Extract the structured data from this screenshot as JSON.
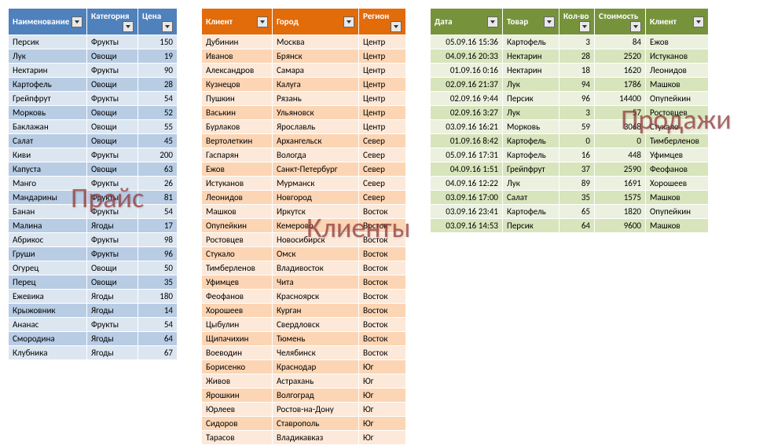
{
  "watermarks": {
    "t1": "Прайс",
    "t2": "Клиенты",
    "t3": "Продажи"
  },
  "chart_data": [
    {
      "type": "table",
      "name": "price",
      "cols": [
        "Наименование",
        "Категория",
        "Цена"
      ],
      "widths": [
        100,
        65,
        50
      ],
      "rows": [
        [
          "Персик",
          "Фрукты",
          "150"
        ],
        [
          "Лук",
          "Овощи",
          "19"
        ],
        [
          "Нектарин",
          "Фрукты",
          "90"
        ],
        [
          "Картофель",
          "Овощи",
          "28"
        ],
        [
          "Грейпфрут",
          "Фрукты",
          "54"
        ],
        [
          "Морковь",
          "Овощи",
          "52"
        ],
        [
          "Баклажан",
          "Овощи",
          "55"
        ],
        [
          "Салат",
          "Овощи",
          "45"
        ],
        [
          "Киви",
          "Фрукты",
          "200"
        ],
        [
          "Капуста",
          "Овощи",
          "63"
        ],
        [
          "Манго",
          "Фрукты",
          "26"
        ],
        [
          "Мандарины",
          "Фрукты",
          "81"
        ],
        [
          "Банан",
          "Фрукты",
          "54"
        ],
        [
          "Малина",
          "Ягоды",
          "17"
        ],
        [
          "Абрикос",
          "Фрукты",
          "98"
        ],
        [
          "Груши",
          "Фрукты",
          "96"
        ],
        [
          "Огурец",
          "Овощи",
          "50"
        ],
        [
          "Перец",
          "Овощи",
          "35"
        ],
        [
          "Ежевика",
          "Ягоды",
          "180"
        ],
        [
          "Крыжовник",
          "Ягоды",
          "14"
        ],
        [
          "Ананас",
          "Фрукты",
          "54"
        ],
        [
          "Смородина",
          "Ягоды",
          "64"
        ],
        [
          "Клубника",
          "Ягоды",
          "67"
        ]
      ]
    },
    {
      "type": "table",
      "name": "clients",
      "cols": [
        "Клиент",
        "Город",
        "Регион"
      ],
      "widths": [
        90,
        110,
        60
      ],
      "rows": [
        [
          "Дубинин",
          "Москва",
          "Центр"
        ],
        [
          "Иванов",
          "Брянск",
          "Центр"
        ],
        [
          "Александров",
          "Самара",
          "Центр"
        ],
        [
          "Кузнецов",
          "Калуга",
          "Центр"
        ],
        [
          "Пушкин",
          "Рязань",
          "Центр"
        ],
        [
          "Васькин",
          "Ульяновск",
          "Центр"
        ],
        [
          "Бурлаков",
          "Ярославль",
          "Центр"
        ],
        [
          "Вертолеткин",
          "Архангельск",
          "Север"
        ],
        [
          "Гаспарян",
          "Вологда",
          "Север"
        ],
        [
          "Ежов",
          "Санкт-Петербург",
          "Север"
        ],
        [
          "Истуканов",
          "Мурманск",
          "Север"
        ],
        [
          "Леонидов",
          "Новгород",
          "Север"
        ],
        [
          "Машков",
          "Иркутск",
          "Восток"
        ],
        [
          "Опупейкин",
          "Кемерово",
          "Восток"
        ],
        [
          "Ростовцев",
          "Новосибирск",
          "Восток"
        ],
        [
          "Стукало",
          "Омск",
          "Восток"
        ],
        [
          "Тимберленов",
          "Владивосток",
          "Восток"
        ],
        [
          "Уфимцев",
          "Чита",
          "Восток"
        ],
        [
          "Феофанов",
          "Красноярск",
          "Восток"
        ],
        [
          "Хорошеев",
          "Курган",
          "Восток"
        ],
        [
          "Цыбулин",
          "Свердловск",
          "Восток"
        ],
        [
          "Щипачихин",
          "Тюмень",
          "Восток"
        ],
        [
          "Воеводин",
          "Челябинск",
          "Восток"
        ],
        [
          "Борисенко",
          "Краснодар",
          "Юг"
        ],
        [
          "Живов",
          "Астрахань",
          "Юг"
        ],
        [
          "Ярошкин",
          "Волгоград",
          "Юг"
        ],
        [
          "Юрлеев",
          "Ростов-на-Дону",
          "Юг"
        ],
        [
          "Сидоров",
          "Ставрополь",
          "Юг"
        ],
        [
          "Тарасов",
          "Владикавказ",
          "Юг"
        ]
      ]
    },
    {
      "type": "table",
      "name": "sales",
      "cols": [
        "Дата",
        "Товар",
        "Кол-во",
        "Стоимость",
        "Клиент"
      ],
      "widths": [
        92,
        72,
        45,
        65,
        80
      ],
      "rows": [
        [
          "05.09.16 15:36",
          "Картофель",
          "3",
          "84",
          "Ежов"
        ],
        [
          "04.09.16 20:33",
          "Нектарин",
          "28",
          "2520",
          "Истуканов"
        ],
        [
          "01.09.16 0:16",
          "Нектарин",
          "18",
          "1620",
          "Леонидов"
        ],
        [
          "02.09.16 21:37",
          "Лук",
          "94",
          "1786",
          "Машков"
        ],
        [
          "02.09.16 9:44",
          "Персик",
          "96",
          "14400",
          "Опупейкин"
        ],
        [
          "02.09.16 3:27",
          "Лук",
          "3",
          "57",
          "Ростовцев"
        ],
        [
          "03.09.16 16:21",
          "Морковь",
          "59",
          "3068",
          "Стукало"
        ],
        [
          "01.09.16 8:42",
          "Картофель",
          "0",
          "0",
          "Тимберленов"
        ],
        [
          "05.09.16 17:31",
          "Картофель",
          "16",
          "448",
          "Уфимцев"
        ],
        [
          "04.09.16 1:51",
          "Грейпфрут",
          "37",
          "2590",
          "Феофанов"
        ],
        [
          "04.09.16 12:22",
          "Лук",
          "89",
          "1691",
          "Хорошеев"
        ],
        [
          "03.09.16 17:00",
          "Салат",
          "35",
          "1575",
          "Машков"
        ],
        [
          "03.09.16 23:41",
          "Картофель",
          "65",
          "1820",
          "Опупейкин"
        ],
        [
          "03.09.16 14:53",
          "Персик",
          "64",
          "9600",
          "Машков"
        ]
      ]
    }
  ]
}
